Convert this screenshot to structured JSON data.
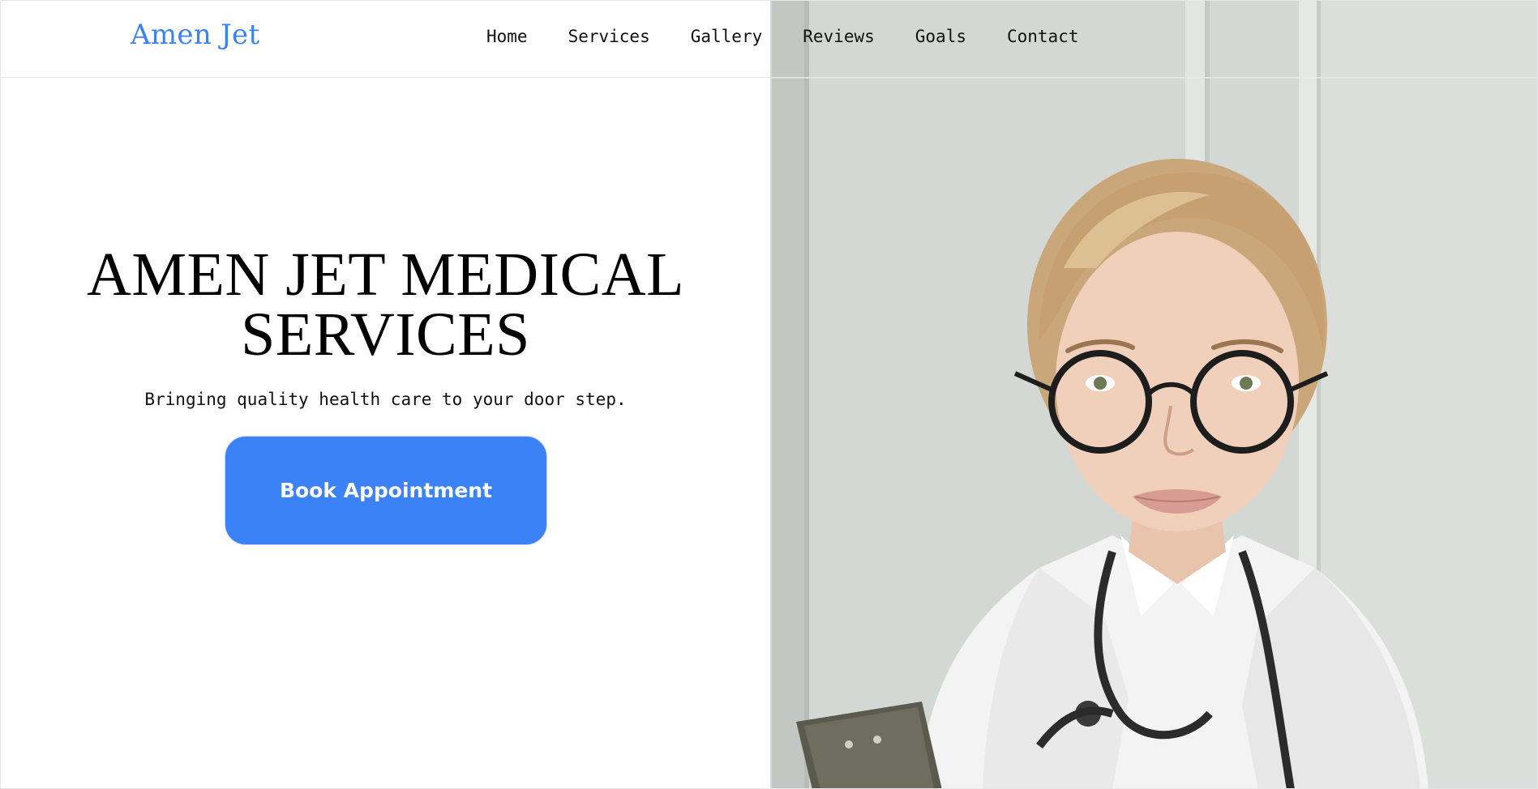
{
  "header": {
    "brand": "Amen Jet",
    "nav": [
      {
        "label": "Home"
      },
      {
        "label": "Services"
      },
      {
        "label": "Gallery"
      },
      {
        "label": "Reviews"
      },
      {
        "label": "Goals"
      },
      {
        "label": "Contact"
      }
    ]
  },
  "hero": {
    "title_line1": "AMEN JET MEDICAL",
    "title_line2": "SERVICES",
    "subtitle": "Bringing quality health care to your door step.",
    "cta_label": "Book Appointment"
  },
  "colors": {
    "accent": "#3b82f6",
    "text": "#000000",
    "background": "#ffffff"
  }
}
